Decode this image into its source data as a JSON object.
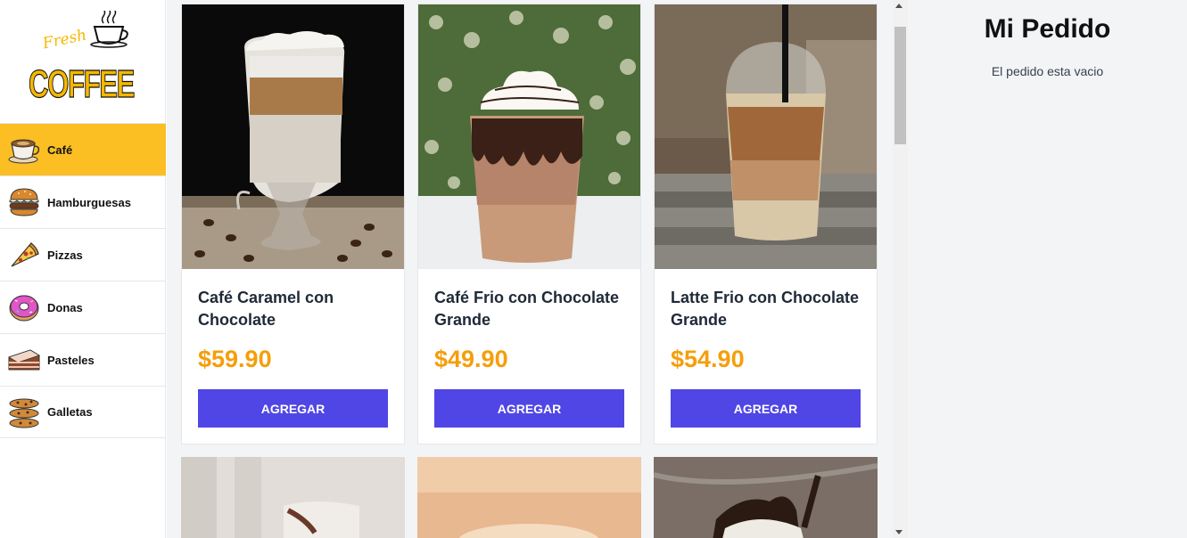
{
  "logo": {
    "script_text": "Fresh",
    "main_text": "COFFEE"
  },
  "categories": [
    {
      "label": "Café",
      "icon": "coffee-cup-icon",
      "active": true
    },
    {
      "label": "Hamburguesas",
      "icon": "burger-icon",
      "active": false
    },
    {
      "label": "Pizzas",
      "icon": "pizza-slice-icon",
      "active": false
    },
    {
      "label": "Donas",
      "icon": "donut-icon",
      "active": false
    },
    {
      "label": "Pasteles",
      "icon": "cake-slice-icon",
      "active": false
    },
    {
      "label": "Galletas",
      "icon": "cookies-icon",
      "active": false
    }
  ],
  "products": [
    {
      "name": "Café Caramel con Chocolate",
      "price": "$59.90",
      "button": "Agregar"
    },
    {
      "name": "Café Frio con Chocolate Grande",
      "price": "$49.90",
      "button": "Agregar"
    },
    {
      "name": "Latte Frio con Chocolate Grande",
      "price": "$54.90",
      "button": "Agregar"
    }
  ],
  "order": {
    "title": "Mi Pedido",
    "empty_message": "El pedido esta vacio"
  },
  "colors": {
    "active_category": "#fbbf24",
    "price": "#f59e0b",
    "button": "#4f46e5",
    "panel_bg": "#f3f4f6"
  }
}
